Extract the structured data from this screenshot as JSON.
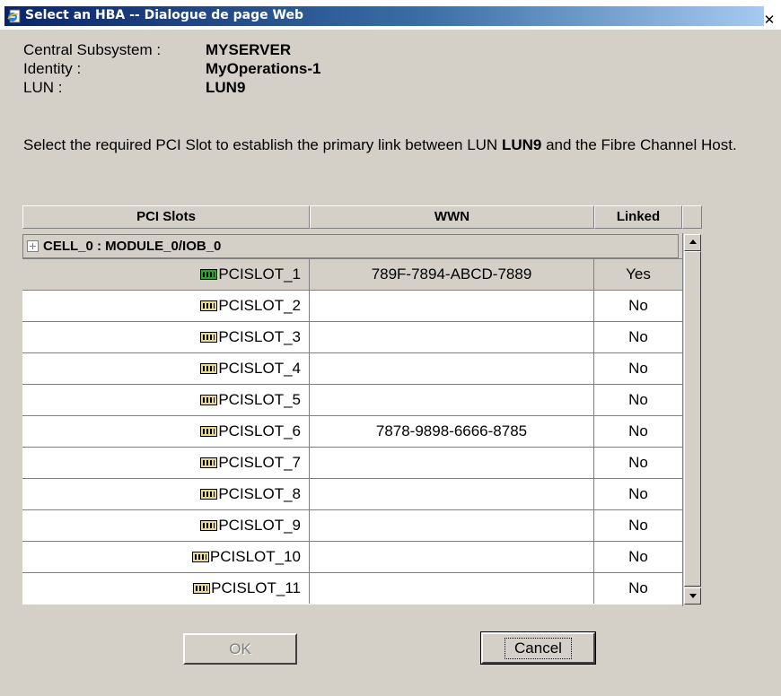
{
  "window": {
    "title": "Select an HBA -- Dialogue de page Web",
    "close_symbol": "✕"
  },
  "info": {
    "subsystem_label": "Central Subsystem :",
    "subsystem_value": "MYSERVER",
    "identity_label": "Identity :",
    "identity_value": "MyOperations-1",
    "lun_label": "LUN :",
    "lun_value": "LUN9"
  },
  "instruction": {
    "before": "Select the required PCI Slot to establish the primary link between LUN ",
    "lun": "LUN9",
    "after": " and the Fibre Channel Host."
  },
  "table": {
    "headers": {
      "slots": "PCI Slots",
      "wwn": "WWN",
      "linked": "Linked"
    },
    "group": "CELL_0 : MODULE_0/IOB_0",
    "rows": [
      {
        "slot": "PCISLOT_1",
        "wwn": "789F-7894-ABCD-7889",
        "linked": "Yes"
      },
      {
        "slot": "PCISLOT_2",
        "wwn": "",
        "linked": "No"
      },
      {
        "slot": "PCISLOT_3",
        "wwn": "",
        "linked": "No"
      },
      {
        "slot": "PCISLOT_4",
        "wwn": "",
        "linked": "No"
      },
      {
        "slot": "PCISLOT_5",
        "wwn": "",
        "linked": "No"
      },
      {
        "slot": "PCISLOT_6",
        "wwn": "7878-9898-6666-8785",
        "linked": "No"
      },
      {
        "slot": "PCISLOT_7",
        "wwn": "",
        "linked": "No"
      },
      {
        "slot": "PCISLOT_8",
        "wwn": "",
        "linked": "No"
      },
      {
        "slot": "PCISLOT_9",
        "wwn": "",
        "linked": "No"
      },
      {
        "slot": "PCISLOT_10",
        "wwn": "",
        "linked": "No"
      },
      {
        "slot": "PCISLOT_11",
        "wwn": "",
        "linked": "No"
      }
    ]
  },
  "buttons": {
    "ok": "OK",
    "cancel": "Cancel"
  },
  "icons": {
    "app": "ie-dialog-icon",
    "slot": "pci-slot-icon",
    "slot_active": "pci-slot-active-icon",
    "expand": "expand-icon"
  },
  "colors": {
    "title_gradient_start": "#0a246a",
    "title_gradient_end": "#a6caf0",
    "face": "#d4d0c8",
    "slot_active": "#22aa22",
    "slot_inactive": "#e8d890"
  }
}
